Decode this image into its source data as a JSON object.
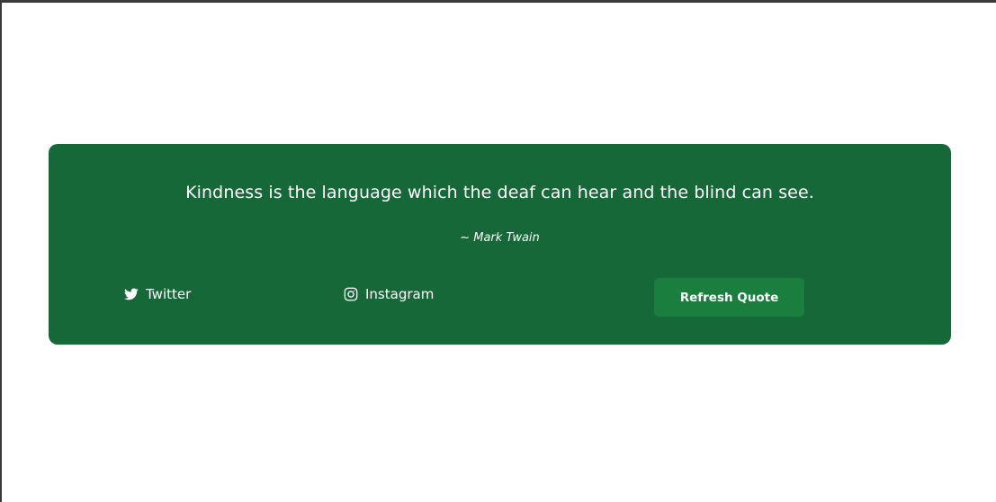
{
  "quote": {
    "text": "Kindness is the language which the deaf can hear and the blind can see.",
    "author": "~ Mark Twain"
  },
  "social": {
    "twitter": {
      "label": "Twitter",
      "icon": "twitter-icon"
    },
    "instagram": {
      "label": "Instagram",
      "icon": "instagram-icon"
    }
  },
  "actions": {
    "refresh_label": "Refresh Quote"
  },
  "colors": {
    "card_background": "#176838",
    "button_background": "#1a7f3e",
    "text": "#ffffff",
    "page_background": "#ffffff"
  }
}
